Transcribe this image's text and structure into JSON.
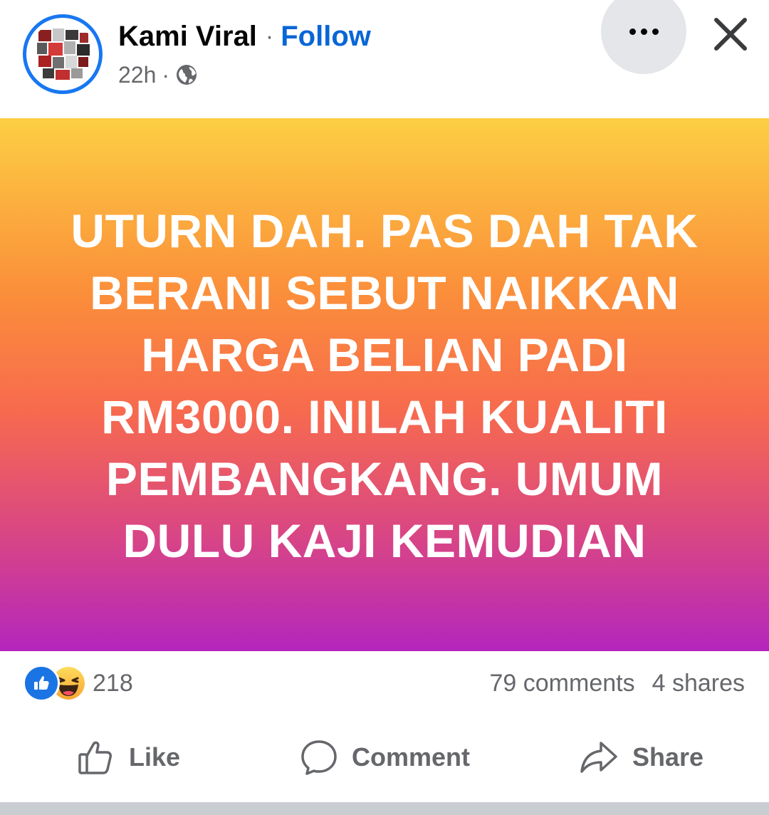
{
  "header": {
    "author_name": "Kami Viral",
    "separator": "·",
    "follow_label": "Follow",
    "timestamp": "22h",
    "meta_separator": "·",
    "privacy_icon": "globe-icon",
    "more_icon": "more-options-icon",
    "close_icon": "close-icon"
  },
  "post": {
    "text": "UTURN DAH. PAS DAH TAK BERANI SEBUT NAIKKAN HARGA BELIAN PADI RM3000. INILAH KUALITI PEMBANGKANG. UMUM DULU KAJI KEMUDIAN",
    "gradient_colors": [
      "#fcce43",
      "#fb8e3a",
      "#f76a4e",
      "#d94684",
      "#b426bd"
    ]
  },
  "stats": {
    "reaction_icons": [
      "like-icon",
      "haha-icon"
    ],
    "reaction_count": "218",
    "comments": "79 comments",
    "shares": "4 shares"
  },
  "actions": {
    "like_label": "Like",
    "comment_label": "Comment",
    "share_label": "Share"
  },
  "colors": {
    "brand": "#1877f2",
    "follow": "#0866d6",
    "secondary_text": "#65676b",
    "primary_text": "#050505"
  }
}
